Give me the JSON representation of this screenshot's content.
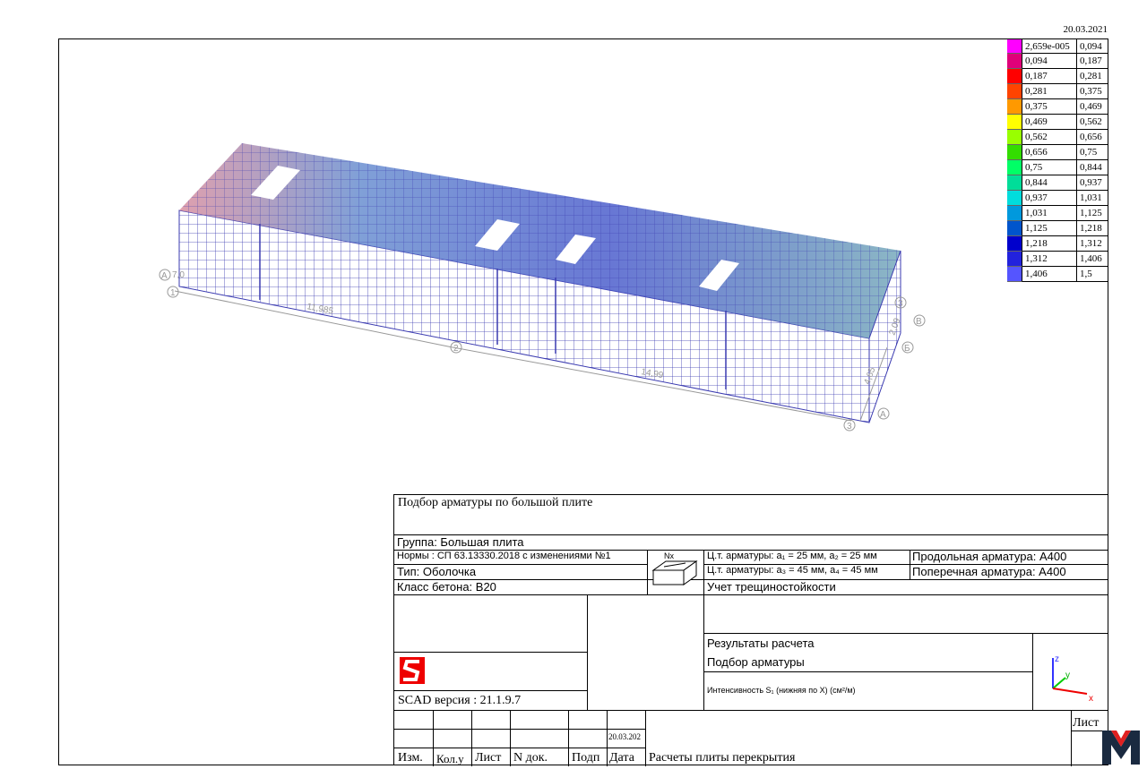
{
  "date_top": "20.03.2021",
  "legend": {
    "rows": [
      {
        "from": "2,659e-005",
        "to": "0,094",
        "color": "#ff00ff"
      },
      {
        "from": "0,094",
        "to": "0,187",
        "color": "#e0007a"
      },
      {
        "from": "0,187",
        "to": "0,281",
        "color": "#ff0000"
      },
      {
        "from": "0,281",
        "to": "0,375",
        "color": "#ff4400"
      },
      {
        "from": "0,375",
        "to": "0,469",
        "color": "#ff9900"
      },
      {
        "from": "0,469",
        "to": "0,562",
        "color": "#ffff00"
      },
      {
        "from": "0,562",
        "to": "0,656",
        "color": "#99ff00"
      },
      {
        "from": "0,656",
        "to": "0,75",
        "color": "#33dd00"
      },
      {
        "from": "0,75",
        "to": "0,844",
        "color": "#00ff66"
      },
      {
        "from": "0,844",
        "to": "0,937",
        "color": "#00dd99"
      },
      {
        "from": "0,937",
        "to": "1,031",
        "color": "#00dddd"
      },
      {
        "from": "1,031",
        "to": "1,125",
        "color": "#0099dd"
      },
      {
        "from": "1,125",
        "to": "1,218",
        "color": "#0055cc"
      },
      {
        "from": "1,218",
        "to": "1,312",
        "color": "#0000cc"
      },
      {
        "from": "1,312",
        "to": "1,406",
        "color": "#2222dd"
      },
      {
        "from": "1,406",
        "to": "1,5",
        "color": "#5555ff"
      }
    ]
  },
  "model": {
    "axes": {
      "a1": "A",
      "one": "1",
      "two": "2",
      "three_a": "3",
      "three_b": "3",
      "b_label": "В",
      "be_label": "Б",
      "a2": "A"
    },
    "dims": {
      "d1": "11,985",
      "d2": "14,99",
      "d3": "4,65",
      "d4": "2,09",
      "d5": "7,0"
    }
  },
  "title_block": {
    "title": "Подбор арматуры по большой плите",
    "group": "Группа: Большая плита",
    "norms": "Нормы : СП 63.13330.2018 с изменениями №1",
    "type": "Тип: Оболочка",
    "concrete": "Класс бетона: B20",
    "rebar_ct1": "Ц.т. арматуры: a₁ = 25 мм, a₂ = 25 мм",
    "rebar_ct2": "Ц.т. арматуры: a₃ = 45 мм, a₄ = 45 мм",
    "longitudinal": "Продольная арматура: A400",
    "transverse": "Поперечная арматура: A400",
    "crack": "Учет трещиностойкости",
    "results": "Результаты расчета",
    "selection": "Подбор арматуры",
    "intensity": "Интенсивность S₁ (нижняя по X) (см²/м)",
    "version": "SCAD версия : 21.1.9.7",
    "date_small": "20.03.202",
    "sheet": "Лист",
    "cols": {
      "izm": "Изм.",
      "kolu": "Кол.у",
      "list": "Лист",
      "ndok": "N док.",
      "podp": "Подп",
      "data": "Дата"
    },
    "project": "Расчеты плиты перекрытия",
    "nx": "Nx",
    "axis_z": "z",
    "axis_y": "y",
    "axis_x": "x"
  }
}
